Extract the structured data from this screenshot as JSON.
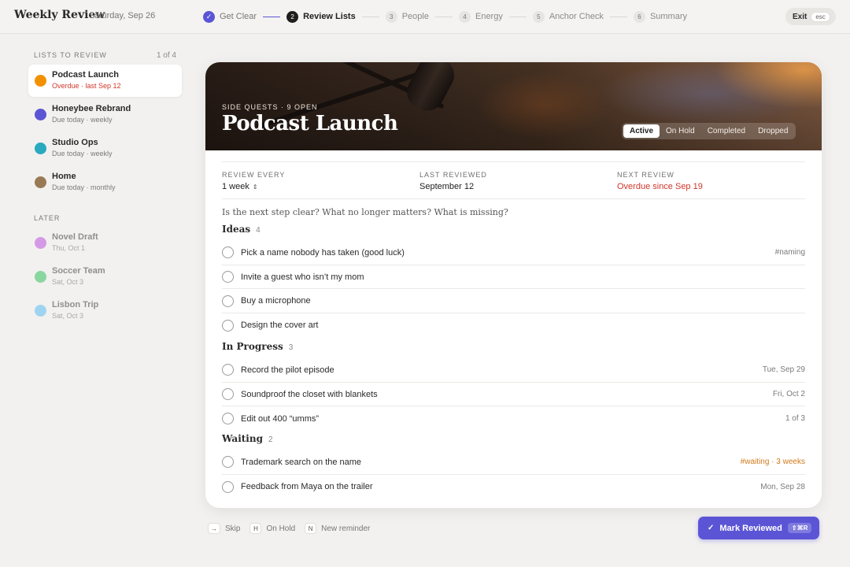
{
  "app": {
    "title": "Weekly Review",
    "date": "Saturday, Sep 26"
  },
  "steps": [
    {
      "num": "✓",
      "label": "Get Clear",
      "state": "done"
    },
    {
      "num": "2",
      "label": "Review Lists",
      "state": "current"
    },
    {
      "num": "3",
      "label": "People",
      "state": "todo"
    },
    {
      "num": "4",
      "label": "Energy",
      "state": "todo"
    },
    {
      "num": "5",
      "label": "Anchor Check",
      "state": "todo"
    },
    {
      "num": "6",
      "label": "Summary",
      "state": "todo"
    }
  ],
  "exit": {
    "label": "Exit",
    "kbd": "esc"
  },
  "sidebar": {
    "heading": "LISTS TO REVIEW",
    "count": "1 of 4",
    "items": [
      {
        "name": "Podcast Launch",
        "sub": "Overdue · last Sep 12",
        "color": "#f29100",
        "active": true,
        "overdue": true
      },
      {
        "name": "Honeybee Rebrand",
        "sub": "Due today · weekly",
        "color": "#5b55d6",
        "active": false,
        "overdue": false
      },
      {
        "name": "Studio Ops",
        "sub": "Due today · weekly",
        "color": "#2aa9bf",
        "active": false,
        "overdue": false
      },
      {
        "name": "Home",
        "sub": "Due today · monthly",
        "color": "#9a7a55",
        "active": false,
        "overdue": false
      }
    ],
    "later_heading": "LATER",
    "later": [
      {
        "name": "Novel Draft",
        "sub": "Thu, Oct 1",
        "color": "#d49ae6"
      },
      {
        "name": "Soccer Team",
        "sub": "Sat, Oct 3",
        "color": "#8ad6a0"
      },
      {
        "name": "Lisbon Trip",
        "sub": "Sat, Oct 3",
        "color": "#9ed4f2"
      }
    ]
  },
  "card": {
    "kicker": "SIDE QUESTS · 9 OPEN",
    "title": "Podcast Launch",
    "status_options": [
      "Active",
      "On Hold",
      "Completed",
      "Dropped"
    ],
    "status_selected": "Active",
    "meta": {
      "review_every_label": "REVIEW EVERY",
      "review_every_value": "1 week",
      "last_reviewed_label": "LAST REVIEWED",
      "last_reviewed_value": "September 12",
      "next_review_label": "NEXT REVIEW",
      "next_review_value": "Overdue since Sep 19"
    },
    "prompt": "Is the next step clear? What no longer matters? What is missing?",
    "sections": [
      {
        "title": "Ideas",
        "count": "4",
        "tasks": [
          {
            "text": "Pick a name nobody has taken (good luck)",
            "meta": "#naming",
            "tone": ""
          },
          {
            "text": "Invite a guest who isn’t my mom",
            "meta": "",
            "tone": ""
          },
          {
            "text": "Buy a microphone",
            "meta": "",
            "tone": ""
          },
          {
            "text": "Design the cover art",
            "meta": "",
            "tone": ""
          }
        ]
      },
      {
        "title": "In Progress",
        "count": "3",
        "tasks": [
          {
            "text": "Record the pilot episode",
            "meta": "Tue, Sep 29",
            "tone": ""
          },
          {
            "text": "Soundproof the closet with blankets",
            "meta": "Fri, Oct 2",
            "tone": ""
          },
          {
            "text": "Edit out 400 “umms”",
            "meta": "1 of 3",
            "tone": ""
          }
        ]
      },
      {
        "title": "Waiting",
        "count": "2",
        "tasks": [
          {
            "text": "Trademark search on the name",
            "meta": "#waiting · 3 weeks",
            "tone": "orange"
          },
          {
            "text": "Feedback from Maya on the trailer",
            "meta": "Mon, Sep 28",
            "tone": ""
          }
        ]
      }
    ]
  },
  "hints": [
    {
      "kbd": "→",
      "label": "Skip"
    },
    {
      "kbd": "H",
      "label": "On Hold"
    },
    {
      "kbd": "N",
      "label": "New reminder"
    }
  ],
  "primary": {
    "label": "Mark Reviewed",
    "kbd": "⇧⌘R"
  },
  "colors": {
    "accent": "#5b55d6",
    "overdue": "#d0362a",
    "waiting": "#d27a1c"
  }
}
